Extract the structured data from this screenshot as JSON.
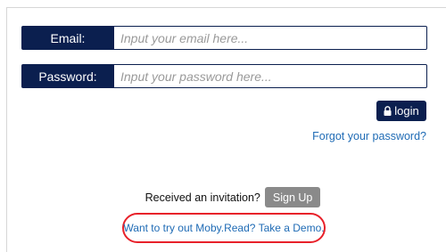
{
  "login_form": {
    "email": {
      "label": "Email:",
      "placeholder": "Input your email here...",
      "value": ""
    },
    "password": {
      "label": "Password:",
      "placeholder": "Input your password here...",
      "value": ""
    },
    "login_button": {
      "label": "login",
      "icon": "lock-icon"
    },
    "forgot_password_link": "Forgot your password?"
  },
  "invitation": {
    "text": "Received an invitation?",
    "signup_button": "Sign Up"
  },
  "demo": {
    "link_text": "Want to try out Moby.Read? Take a Demo.",
    "highlight_color": "#e8212a"
  },
  "colors": {
    "navy": "#0b1f4f",
    "link_blue": "#1f6bb5",
    "signup_gray": "#8a8a8a"
  }
}
